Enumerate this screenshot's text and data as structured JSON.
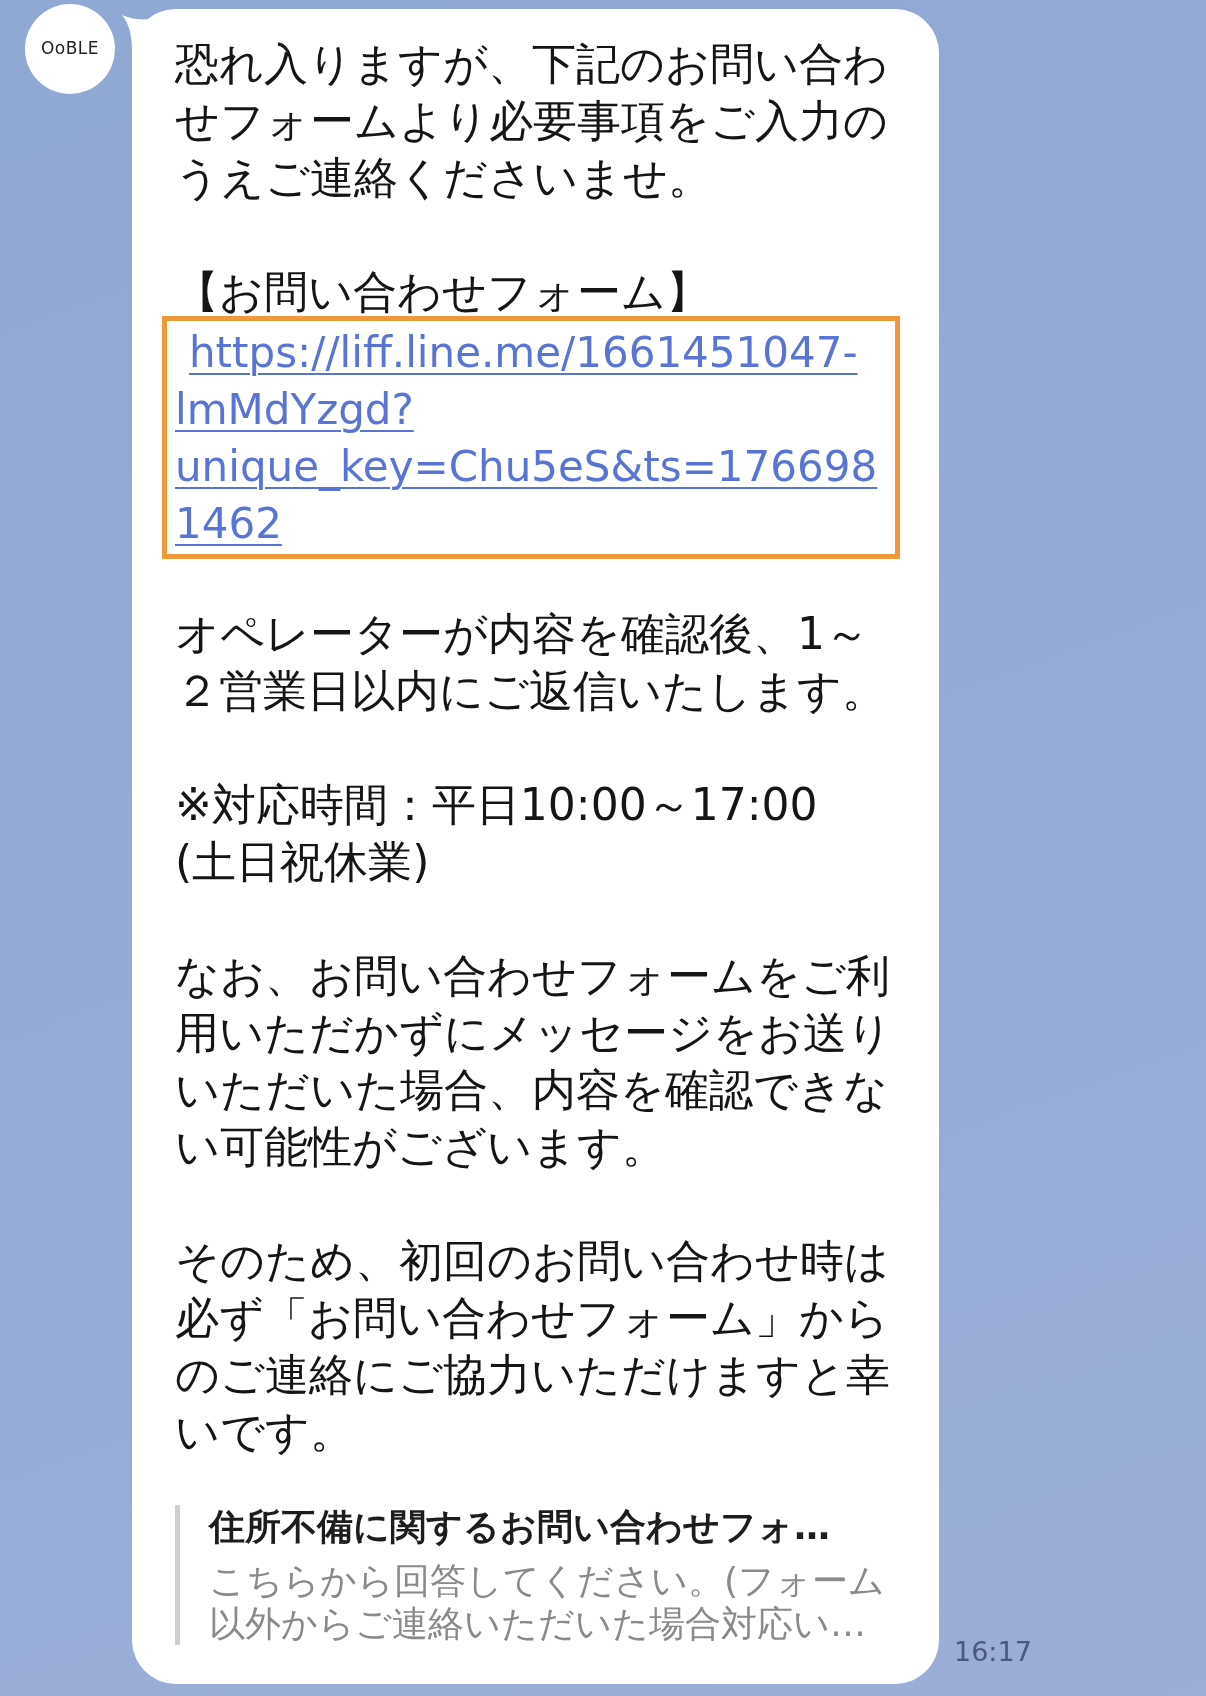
{
  "avatar": {
    "label": "OoBLE"
  },
  "message": {
    "blocks": [
      {
        "kind": "text",
        "lines": [
          "恐れ入りますが、下記のお問い合わ",
          "せフォームより必要事項をご入力の",
          "うえご連絡くださいませ。"
        ]
      },
      {
        "kind": "link",
        "heading": "【お問い合わせフォーム】",
        "link_lines": [
          "https://liff.line.me/1661451047-",
          "lmMdYzgd?",
          "unique_key=Chu5eS&ts=176698",
          "1462"
        ],
        "highlighted": true
      },
      {
        "kind": "text",
        "lines": [
          "オペレーターが内容を確認後、1～",
          "２営業日以内にご返信いたします。"
        ]
      },
      {
        "kind": "text",
        "lines": [
          "※対応時間：平日10:00～17:00",
          "(土日祝休業)"
        ]
      },
      {
        "kind": "text",
        "lines": [
          "なお、お問い合わせフォームをご利",
          "用いただかずにメッセージをお送り",
          "いただいた場合、内容を確認できな",
          "い可能性がございます。"
        ]
      },
      {
        "kind": "text",
        "lines": [
          "そのため、初回のお問い合わせ時は",
          "必ず「お問い合わせフォーム」から",
          "のご連絡にご協力いただけますと幸",
          "いです。"
        ]
      }
    ],
    "preview": {
      "title": "住所不備に関するお問い合わせフォ…",
      "description_lines": [
        "こちらから回答してください。(フォーム",
        "以外からご連絡いただいた場合対応い…"
      ]
    },
    "time": "16:17"
  }
}
